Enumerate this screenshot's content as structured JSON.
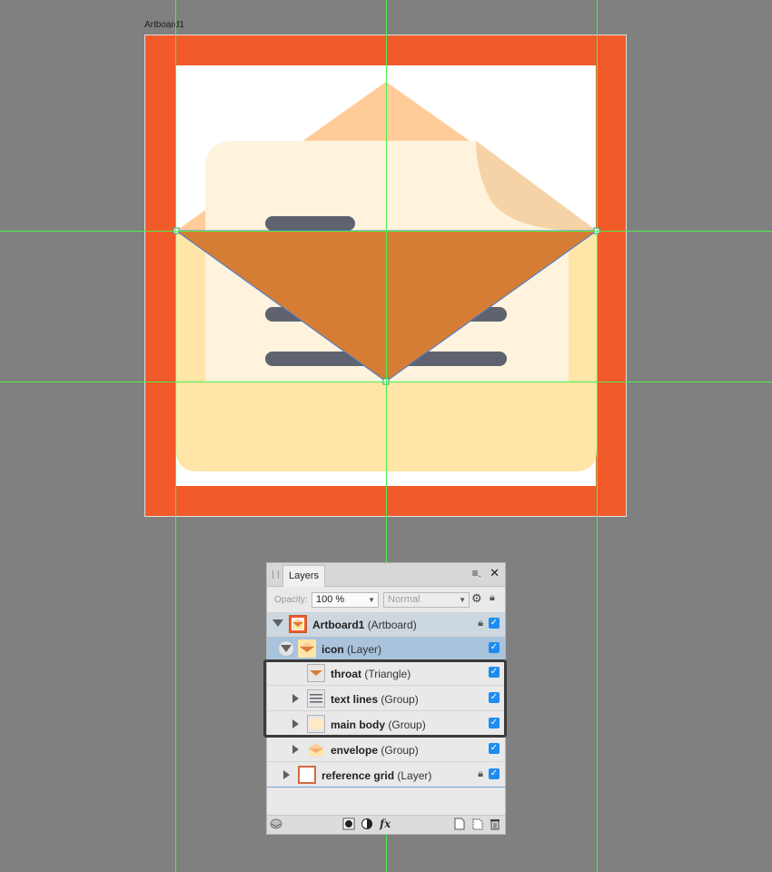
{
  "artboard_label": "Artboard1",
  "colors": {
    "background": "#808080",
    "reference_grid": "#f15a29",
    "envelope_flap": "#ffcc99",
    "paper": "#fff3dd",
    "paper_fold": "#f5d3a7",
    "body": "#ffe5a8",
    "throat": "#d67d35",
    "text_lines": "#5f6370",
    "guide": "#4cf04c",
    "checkbox": "#1e8cf0"
  },
  "layers_panel": {
    "tab_label": "Layers",
    "menu_icon": "panel-menu-icon",
    "close_icon": "close-icon",
    "opacity_label": "Opacity:",
    "opacity_value": "100 %",
    "blend_mode": "Normal",
    "rows": [
      {
        "name": "Artboard1",
        "type": "(Artboard)",
        "locked": true,
        "visible": true
      },
      {
        "name": "icon",
        "type": "(Layer)",
        "locked": false,
        "visible": true
      },
      {
        "name": "throat",
        "type": "(Triangle)",
        "locked": false,
        "visible": true
      },
      {
        "name": "text lines",
        "type": "(Group)",
        "locked": false,
        "visible": true
      },
      {
        "name": "main body",
        "type": "(Group)",
        "locked": false,
        "visible": true
      },
      {
        "name": "envelope",
        "type": "(Group)",
        "locked": false,
        "visible": true
      },
      {
        "name": "reference grid",
        "type": "(Layer)",
        "locked": true,
        "visible": true
      }
    ],
    "footer_icons": [
      "layers-icon",
      "mask-icon",
      "adjustment-icon",
      "fx-icon",
      "new-layer-icon",
      "new-pixel-layer-icon",
      "trash-icon"
    ],
    "fx_label": "fx"
  }
}
